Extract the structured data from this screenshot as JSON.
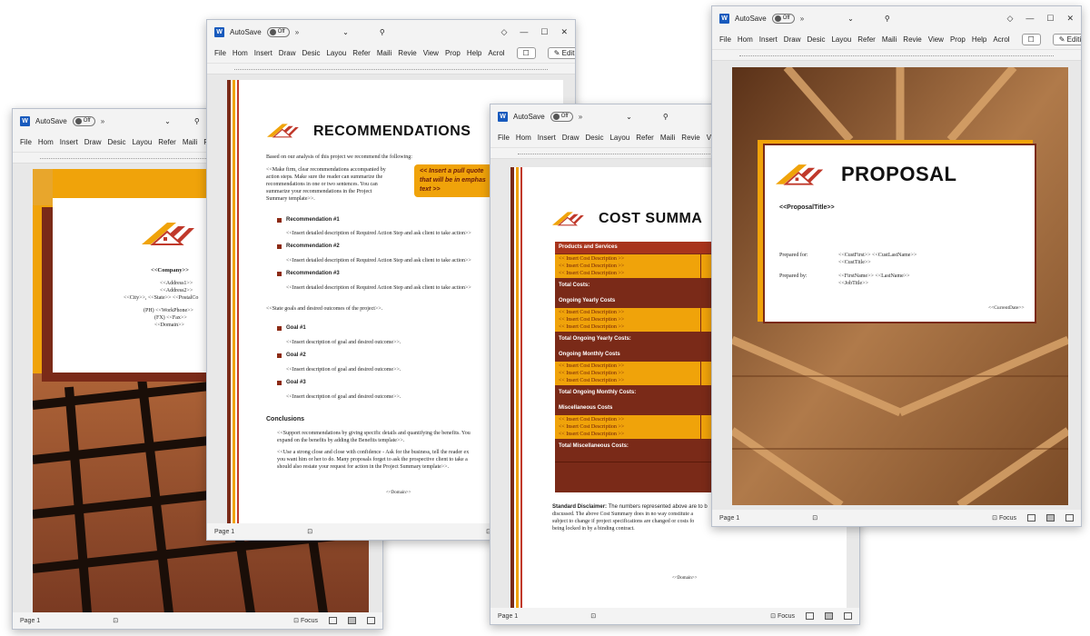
{
  "app": {
    "autosave_label": "AutoSave",
    "autosave_state": "Off",
    "editing_label": "Editing",
    "page_label": "Page 1",
    "focus_label": "Focus"
  },
  "ribbon_tabs": [
    "File",
    "Home",
    "Insert",
    "Draw",
    "Design",
    "Layout",
    "References",
    "Mailings",
    "Review",
    "View",
    "Proposal",
    "Help",
    "Acrobat"
  ],
  "ribbon_visible": {
    "w1": [
      "File",
      "Hom",
      "Insert",
      "Draw",
      "Desic",
      "Layou",
      "Refer",
      "Maili",
      "Rev"
    ],
    "w2": [
      "File",
      "Hom",
      "Insert",
      "Draw",
      "Desic",
      "Layou",
      "Refer",
      "Maili",
      "Revie",
      "View",
      "Prop",
      "Help",
      "Acrol"
    ],
    "w3": [
      "File",
      "Hom",
      "Insert",
      "Draw",
      "Desic",
      "Layou",
      "Refer",
      "Maili",
      "Revie",
      "View"
    ],
    "w4": [
      "File",
      "Hom",
      "Insert",
      "Draw",
      "Desic",
      "Layou",
      "Refer",
      "Maili",
      "Revie",
      "View",
      "Prop",
      "Help",
      "Acrol"
    ]
  },
  "cover": {
    "company": "<<Company>>",
    "address1": "<<Address1>>",
    "address2": "<<Address2>>",
    "citystate": "<<City>>, <<State>> <<PostalCo",
    "phone": "(PH) <<WorkPhone>>",
    "fax": "(FX) <<Fax>>",
    "domain": "<<Domain>>"
  },
  "recommendations": {
    "title": "RECOMMENDATIONS",
    "intro": "Based on our analysis of this project we recommend the following:",
    "body1": "<<Make firm, clear recommendations accompanied by",
    "body2": "action steps.  Make sure the reader can summarize the",
    "body3": "recommendations in one or two sentences.  You can",
    "body4": "summarize your recommendations in the Project",
    "body5": "Summary template>>.",
    "pullquote1": "<< Insert a pull quote",
    "pullquote2": "that will be in emphas",
    "pullquote3": "text >>",
    "rec1": "Recommendation #1",
    "rec2": "Recommendation #2",
    "rec3": "Recommendation #3",
    "rec_detail": "<<Insert detailed description of Required Action Step and ask client to take action>>",
    "state_goals": "<<State goals and desired outcomes of the project>>.",
    "goal1": "Goal #1",
    "goal2": "Goal #2",
    "goal3": "Goal #3",
    "goal_detail": "<<Insert description of goal and desired outcome>>.",
    "conclusions": "Conclusions",
    "conc1": "<<Support recommendations by giving specific details and quantifying the benefits.  You",
    "conc2": "expand on the benefits by adding the Benefits template>>.",
    "conc3": "<<Use a strong close and close with confidence - Ask for the business, tell the reader ex",
    "conc4": "you want him or her to do.  Many proposals forget to ask the prospective client to take a",
    "conc5": "should also restate your request for action in the Project Summary template>>.",
    "domain": "<<Domain>>"
  },
  "cost": {
    "title": "COST SUMMA",
    "sections": [
      {
        "header": "Products and Services",
        "total": "Total Costs:"
      },
      {
        "header": "Ongoing Yearly Costs",
        "total": "Total Ongoing Yearly Costs:"
      },
      {
        "header": "Ongoing Monthly Costs",
        "total": "Total Ongoing Monthly Costs:"
      },
      {
        "header": "Miscellaneous Costs",
        "total": "Total Miscellaneous Costs:"
      }
    ],
    "item": "<< Insert Cost Description >>",
    "disclaimer_label": "Standard Disclaimer:",
    "disc1": " The numbers represented above are to b",
    "disc2": "discussed. The above Cost Summary does in no way constitute a",
    "disc3": "subject to change if project specifications are changed or costs fo",
    "disc4": "being locked in by a binding contract.",
    "domain": "<<Domain>>"
  },
  "proposal": {
    "title": "PROPOSAL",
    "proposal_title": "<<ProposalTitle>>",
    "prepared_for_label": "Prepared for:",
    "prepared_for_1": "<<CustFirst>> <<CustLastName>>",
    "prepared_for_2": "<<CustTitle>>",
    "prepared_by_label": "Prepared by:",
    "prepared_by_1": "<<FirstName>> <<LastName>>",
    "prepared_by_2": "<<JobTitle>>",
    "date": "<<CurrentDate>>"
  },
  "colors": {
    "dark_red": "#7a2a18",
    "orange": "#f0a30a",
    "accent_red": "#c0392b",
    "word_blue": "#185abd"
  }
}
